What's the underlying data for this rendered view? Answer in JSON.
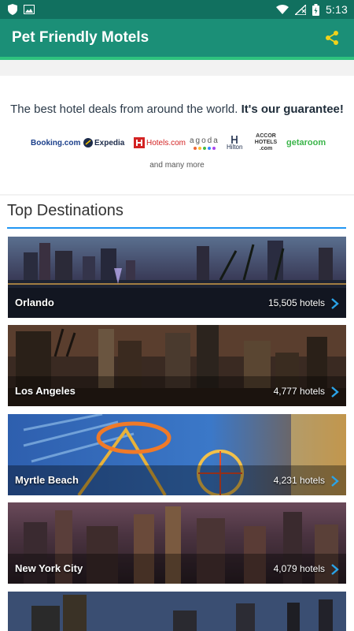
{
  "status_bar": {
    "time": "5:13"
  },
  "app_bar": {
    "title": "Pet Friendly Motels",
    "share_icon": "share-icon"
  },
  "banner": {
    "tagline": "The best hotel deals from around the world.",
    "tagline_bold": "It's our guarantee!",
    "partners": [
      "Booking.com",
      "Expedia",
      "Hotels.com",
      "agoda",
      "Hilton",
      "ACCOR HOTELS .com",
      "getaroom"
    ],
    "more_text": "and many more"
  },
  "section": {
    "title": "Top Destinations"
  },
  "destinations": [
    {
      "city": "Orlando",
      "hotels": "15,505 hotels"
    },
    {
      "city": "Los Angeles",
      "hotels": "4,777 hotels"
    },
    {
      "city": "Myrtle Beach",
      "hotels": "4,231 hotels"
    },
    {
      "city": "New York City",
      "hotels": "4,079 hotels"
    }
  ],
  "colors": {
    "status_bar": "#11705f",
    "app_bar": "#1b8f77",
    "accent_rule": "#2196f3",
    "chevron": "#2aa3e8"
  }
}
